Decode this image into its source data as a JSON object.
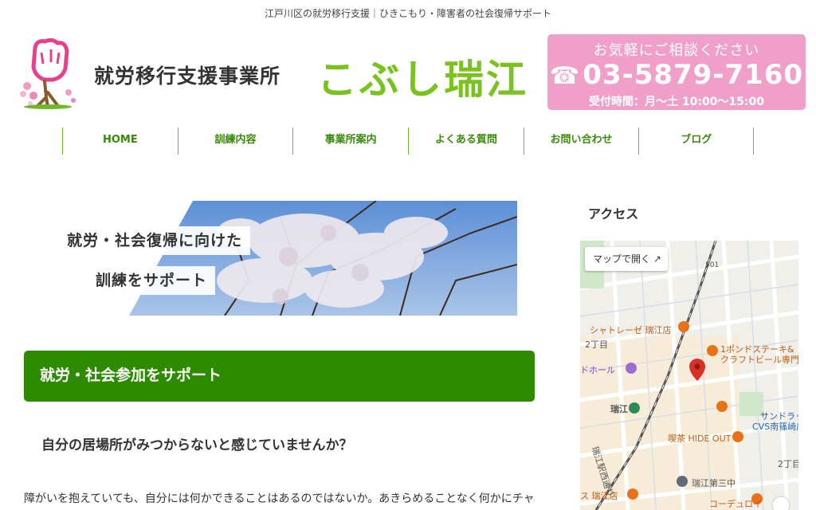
{
  "topline": "江戸川区の就労移行支援｜ひきこもり・障害者の社会復帰サポート",
  "header": {
    "office_name": "就労移行支援事業所",
    "brand": "こぶし瑞江",
    "contact": {
      "lead": "お気軽にご相談ください",
      "tel_icon": "☎",
      "tel": "03-5879-7160",
      "hours": "受付時間：月～土 10:00～15:00"
    }
  },
  "nav": {
    "items": [
      {
        "label": "HOME"
      },
      {
        "label": "訓練内容"
      },
      {
        "label": "事業所案内"
      },
      {
        "label": "よくある質問"
      },
      {
        "label": "お問い合わせ"
      },
      {
        "label": "ブログ"
      }
    ]
  },
  "banner": {
    "caption_line1": "就労・社会復帰に向けた",
    "caption_line2": "訓練をサポート"
  },
  "main": {
    "section_heading": "就労・社会参加をサポート",
    "sub_heading": "自分の居場所がみつからないと感じていませんか？",
    "body": "障がいを抱えていても、自分には何かできることはあるのではないか。あきらめることなく何かにチャレン"
  },
  "sidebar": {
    "title": "アクセス",
    "map": {
      "open_button": "マップで開く",
      "labels": {
        "l1": "シャトレーゼ 瑞江店",
        "l2": "1ポンドステーキ&",
        "l3": "クラフトビール専門",
        "l4": "ドホール",
        "l5": "2丁目",
        "l6": "瑞江",
        "l7": "サンドラッ",
        "l8": "CVS南篠崎店",
        "l9": "喫茶 HIDE OUT",
        "l10": "瑞江駅西通り",
        "l11": "2丁目",
        "l12": "瑞江第三中",
        "l13": "コーデュロイ",
        "l14": "501",
        "l15": "ス 瑞江店"
      }
    }
  }
}
